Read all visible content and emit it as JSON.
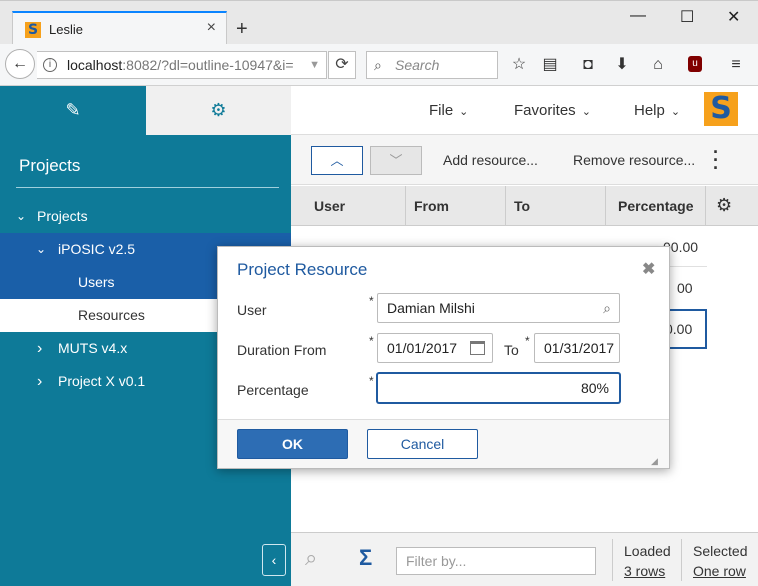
{
  "browser": {
    "tab_title": "Leslie",
    "tab_close": "×",
    "new_tab": "+",
    "url_host": "localhost",
    "url_rest": ":8082/?dl=outline-10947&i=",
    "search_placeholder": "Search"
  },
  "sidebar": {
    "title": "Projects",
    "items": [
      {
        "label": "Projects",
        "chevron": "⌄"
      },
      {
        "label": "iPOSIC v2.5",
        "chevron": "⌄"
      },
      {
        "label": "Users",
        "chevron": ""
      },
      {
        "label": "Resources",
        "chevron": ""
      },
      {
        "label": "MUTS v4.x",
        "chevron": "›"
      },
      {
        "label": "Project X v0.1",
        "chevron": "›"
      }
    ],
    "collapse_glyph": "‹"
  },
  "menubar": {
    "file": "File",
    "favorites": "Favorites",
    "help": "Help"
  },
  "toolbar": {
    "add_resource": "Add resource...",
    "remove_resource": "Remove resource..."
  },
  "grid": {
    "columns": [
      "User",
      "From",
      "To",
      "Percentage"
    ],
    "visible_values": [
      "00.00",
      "00",
      "0.00"
    ]
  },
  "footer": {
    "filter_placeholder": "Filter by...",
    "loaded_label": "Loaded",
    "loaded_value": "3 rows",
    "selected_label": "Selected",
    "selected_value": "One row"
  },
  "dialog": {
    "title": "Project Resource",
    "user_label": "User",
    "user_value": "Damian Milshi",
    "duration_label": "Duration From",
    "from_value": "01/01/2017",
    "to_label": "To",
    "to_value": "01/31/2017",
    "percentage_label": "Percentage",
    "percentage_value": "80%",
    "required_mark": "*",
    "ok_label": "OK",
    "cancel_label": "Cancel"
  },
  "colors": {
    "sidebar": "#0e7a98",
    "accent": "#1f5aa0",
    "logo": "#f6a11c"
  }
}
